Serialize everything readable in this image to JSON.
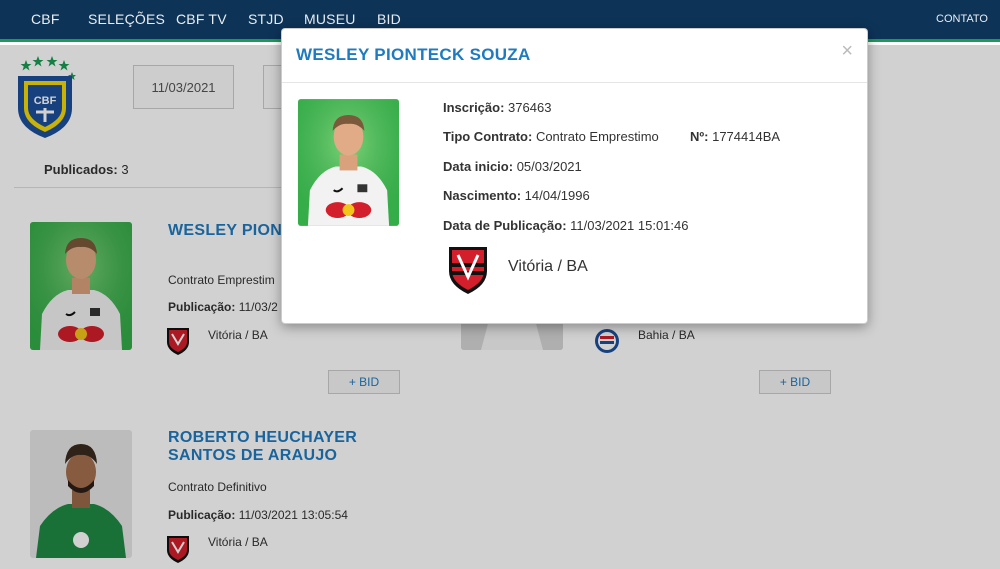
{
  "nav": {
    "items": [
      "CBF",
      "SELEÇÕES",
      "CBF TV",
      "STJD",
      "MUSEU",
      "BID"
    ],
    "contact": "CONTATO"
  },
  "filter": {
    "date": "11/03/2021"
  },
  "summary": {
    "label": "Publicados:",
    "count": "3"
  },
  "cards": [
    {
      "name": "WESLEY PION",
      "contract": "Contrato Emprestim",
      "pub_label": "Publicação:",
      "pub_value": "11/03/2",
      "club": "Vitória / BA",
      "bid": "+ BID"
    },
    {
      "club": "Bahia / BA",
      "bid": "+ BID"
    },
    {
      "name_line1": "ROBERTO HEUCHAYER",
      "name_line2": "SANTOS DE ARAUJO",
      "contract": "Contrato Definitivo",
      "pub_label": "Publicação:",
      "pub_value": "11/03/2021 13:05:54",
      "club": "Vitória / BA"
    }
  ],
  "modal": {
    "title": "WESLEY PIONTECK SOUZA",
    "close": "×",
    "inscricao_label": "Inscrição:",
    "inscricao_value": "376463",
    "tipo_label": "Tipo Contrato:",
    "tipo_value": "Contrato Emprestimo",
    "numero_label": "Nº:",
    "numero_value": "1774414BA",
    "inicio_label": "Data inicio:",
    "inicio_value": "05/03/2021",
    "nascimento_label": "Nascimento:",
    "nascimento_value": "14/04/1996",
    "publicacao_label": "Data de Publicação:",
    "publicacao_value": "11/03/2021 15:01:46",
    "club": "Vitória / BA"
  },
  "colors": {
    "nav_bg": "#0d3357",
    "nav_accent": "#1a9c54",
    "link_blue": "#1f7bbf"
  }
}
